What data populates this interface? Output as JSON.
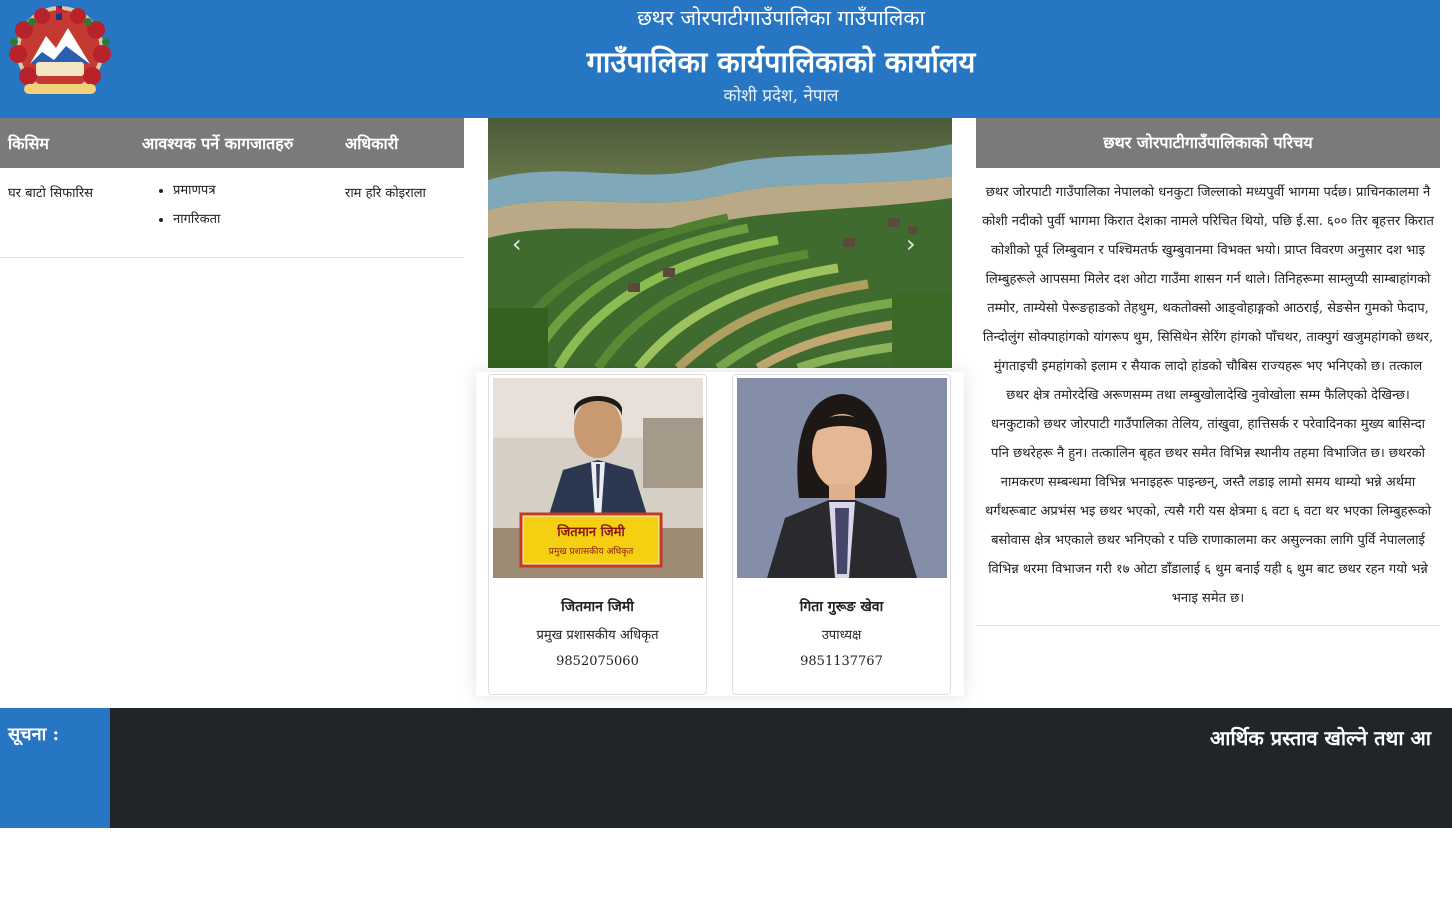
{
  "header": {
    "subtitle": "छथर जोरपाटीगाउँपालिका गाउँपालिका",
    "title": "गाउँपालिका कार्यपालिकाको कार्यालय",
    "location": "कोशी प्रदेश, नेपाल",
    "emblem_icon": "nepal-government-emblem-icon"
  },
  "services": {
    "headers": [
      "किसिम",
      "आवश्यक पर्ने कागजातहरु",
      "अधिकारी"
    ],
    "rows": [
      {
        "type": "घर बाटो सिफारिस",
        "documents": [
          "प्रमाणपत्र",
          "नागरिकता"
        ],
        "officer": "राम हरि कोइराला"
      }
    ]
  },
  "slider": {
    "prev_icon": "chevron-left-icon",
    "prev_glyph": "‹",
    "next_icon": "chevron-right-icon",
    "next_glyph": "›"
  },
  "officials": [
    {
      "name": "जितमान जिमी",
      "designation": "प्रमुख प्रशासकीय अधिकृत",
      "phone": "9852075060",
      "nameplate_line1": "जितमान जिमी",
      "nameplate_line2": "प्रमुख प्रशासकीय अधिकृत"
    },
    {
      "name": "गिता गुरूङ खेवा",
      "designation": "उपाध्यक्ष",
      "phone": "9851137767"
    }
  ],
  "intro": {
    "title": "छथर जोरपाटीगाउँपालिकाको परिचय",
    "body": "छथर जोरपाटी गाउँपालिका नेपालको धनकुटा जिल्लाको मध्यपुर्वी भागमा पर्दछ। प्राचिनकालमा नै कोशी नदीको पुर्वी भागमा किरात देशका नामले परिचित थियो, पछि ई.सा. ६०० तिर बृहत्तर किरात कोशीको पूर्व लिम्बुवान र पश्चिमतर्फ खुम्बुवानमा विभक्त भयो। प्राप्त विवरण अनुसार दश भाइ लिम्बुहरूले आपसमा मिलेर दश ओटा गाउँमा शासन गर्न थाले। तिनिहरूमा साम्लुप्यी साम्बाहांगको तम्मोर, ताम्येसो पेरूङहाङको तेहथुम, थकतोक्सो आङ्वोहाङ्गको आठराई, सेङसेन गुमको फेदाप, तिन्दोलुंग सोक्पाहांगको यांगरूप थुम, सिसिथेन सेरिंग हांगको पाँचथर, ताक्पुगं खजुमहांगको छथर, मुंगताइची इमहांगको इलाम र सैयाक लादो हांडको चौबिस राज्यहरू भए भनिएको छ। तत्काल छथर क्षेत्र तमोरदेखि अरूणसम्म तथा लम्बुखोलादेखि नुवोखोला सम्म फैलिएको देखिन्छ। धनकुटाको छथर जोरपाटी गाउँपालिका तेलिय, तांखुवा, हात्तिसर्क र परेवादिनका मुख्य बासिन्दा पनि छथरेहरू नै हुन। तत्कालिन बृहत छथर समेत विभिन्न स्थानीय तहमा विभाजित छ। छथरको नामकरण सम्बन्धमा विभिन्न भनाइहरू पाइन्छन्, जस्तै लडाइ लामो समय थाम्यो भन्ने अर्थमा थर्गंथरूबाट अप्रभंस भइ छथर भएको, त्यसै गरी यस क्षेत्रमा ६ वटा ६ वटा थर भएका लिम्बुहरूको बसोवास क्षेत्र भएकाले छथर भनिएको र पछि राणाकालमा कर असुल्नका लागि पुर्वि नेपाललाई विभिन्न थरमा विभाजन गरी १७ ओटा डाँडालाई ६ थुम बनाई यही ६ थुम बाट छथर रहन गयो भन्ने भनाइ समेत छ।"
  },
  "notice": {
    "label": "सूचना :",
    "text": "आर्थिक प्रस्ताव खोल्ने तथा आ"
  }
}
